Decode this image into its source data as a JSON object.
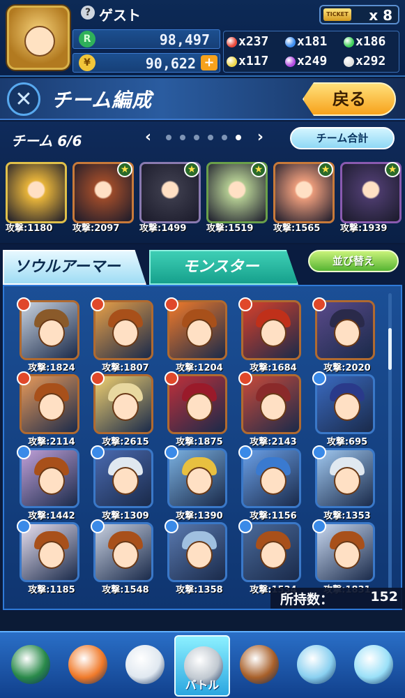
{
  "player": {
    "name": "ゲスト",
    "exp": "98,497",
    "coins": "90,622",
    "coin_add": "+"
  },
  "ticket": {
    "icon_text": "TICKET",
    "count": "x 8"
  },
  "orbs": [
    {
      "color": "#e8483a",
      "icon": "fire-orb-icon",
      "value": "x237"
    },
    {
      "color": "#3e8ef0",
      "icon": "water-orb-icon",
      "value": "x181"
    },
    {
      "color": "#3fd05a",
      "icon": "wood-orb-icon",
      "value": "x186"
    },
    {
      "color": "#f0d84a",
      "icon": "light-orb-icon",
      "value": "x117"
    },
    {
      "color": "#b04ae0",
      "icon": "dark-orb-icon",
      "value": "x249"
    },
    {
      "color": "#e0e0e0",
      "icon": "rainbow-orb-icon",
      "value": "x292"
    }
  ],
  "title": {
    "text": "チーム編成",
    "back": "戻る"
  },
  "team": {
    "label": "チーム 6/6",
    "prev": "‹",
    "next": "›",
    "dots": 6,
    "active_dot": 5,
    "sum_button": "チーム合計",
    "members": [
      {
        "atk": "攻撃:1180",
        "color": "#e6b33a",
        "border": "#e0c04a",
        "star": false
      },
      {
        "atk": "攻撃:2097",
        "color": "#9a4a2a",
        "border": "#c87a3a",
        "star": true
      },
      {
        "atk": "攻撃:1499",
        "color": "#3a3a4a",
        "border": "#8a7ab0",
        "star": true
      },
      {
        "atk": "攻撃:1519",
        "color": "#b0c890",
        "border": "#6aa04a",
        "star": true
      },
      {
        "atk": "攻撃:1565",
        "color": "#e89a7a",
        "border": "#c87a3a",
        "star": true
      },
      {
        "atk": "攻撃:1939",
        "color": "#4a3a6a",
        "border": "#8a5ab0",
        "star": true
      }
    ]
  },
  "tabs": {
    "soul_armor": "ソウルアーマー",
    "monster": "モンスター",
    "sort": "並び替え"
  },
  "grid": [
    {
      "atk": "攻撃:1824",
      "el": "#e0482a",
      "bg": "#c9d3e0",
      "hair": "#8a5a2a",
      "border": "#b06a30"
    },
    {
      "atk": "攻撃:1807",
      "el": "#e0482a",
      "bg": "#e8a048",
      "hair": "#a8501a",
      "border": "#b06a30"
    },
    {
      "atk": "攻撃:1204",
      "el": "#e0482a",
      "bg": "#f07a2a",
      "hair": "#a8501a",
      "border": "#b06a30"
    },
    {
      "atk": "攻撃:1684",
      "el": "#e0482a",
      "bg": "#d8402a",
      "hair": "#c0301a",
      "border": "#b06a30"
    },
    {
      "atk": "攻撃:2020",
      "el": "#e0482a",
      "bg": "#5a4a8a",
      "hair": "#2a2a4a",
      "border": "#b06a30"
    },
    {
      "atk": "攻撃:2114",
      "el": "#e0482a",
      "bg": "#e89a5a",
      "hair": "#a8501a",
      "border": "#b06a30"
    },
    {
      "atk": "攻撃:2615",
      "el": "#e0482a",
      "bg": "#f0d070",
      "hair": "#e8d8a0",
      "border": "#b06a30"
    },
    {
      "atk": "攻撃:1875",
      "el": "#e0482a",
      "bg": "#c0303a",
      "hair": "#9a1a2a",
      "border": "#b06a30"
    },
    {
      "atk": "攻撃:2143",
      "el": "#e0482a",
      "bg": "#c84a3a",
      "hair": "#8a2a2a",
      "border": "#b06a30"
    },
    {
      "atk": "攻撃:695",
      "el": "#3a8ae8",
      "bg": "#3a6ac0",
      "hair": "#2a3a8a",
      "border": "#3a78c8"
    },
    {
      "atk": "攻撃:1442",
      "el": "#3a8ae8",
      "bg": "#c0a0d8",
      "hair": "#a8501a",
      "border": "#3a78c8"
    },
    {
      "atk": "攻撃:1309",
      "el": "#3a8ae8",
      "bg": "#4a6ab0",
      "hair": "#e0e8f0",
      "border": "#3a78c8"
    },
    {
      "atk": "攻撃:1390",
      "el": "#3a8ae8",
      "bg": "#7ab0e0",
      "hair": "#e8c040",
      "border": "#3a78c8"
    },
    {
      "atk": "攻撃:1156",
      "el": "#3a8ae8",
      "bg": "#6aa0e8",
      "hair": "#3a7ad0",
      "border": "#3a78c8"
    },
    {
      "atk": "攻撃:1353",
      "el": "#3a8ae8",
      "bg": "#a0c8f0",
      "hair": "#e0e8f0",
      "border": "#3a78c8"
    },
    {
      "atk": "攻撃:1185",
      "el": "#3a8ae8",
      "bg": "#e8e0f0",
      "hair": "#a8501a",
      "border": "#3a78c8"
    },
    {
      "atk": "攻撃:1548",
      "el": "#3a8ae8",
      "bg": "#c8d0e0",
      "hair": "#a8501a",
      "border": "#3a78c8"
    },
    {
      "atk": "攻撃:1358",
      "el": "#3a8ae8",
      "bg": "#5a7ab0",
      "hair": "#a0c0e0",
      "border": "#3a78c8"
    },
    {
      "atk": "攻撃:1534",
      "el": "#3a8ae8",
      "bg": "#4a6a9a",
      "hair": "#a8501a",
      "border": "#3a78c8"
    },
    {
      "atk": "攻撃:1831",
      "el": "#3a8ae8",
      "bg": "#c8d8f0",
      "hair": "#a8501a",
      "border": "#3a78c8"
    }
  ],
  "owned": {
    "label": "所持数：",
    "count": "152"
  },
  "nav": [
    {
      "name": "nav-home",
      "icon": "home-icon",
      "label": "",
      "color": "#2a8a4a",
      "active": false
    },
    {
      "name": "nav-shop",
      "icon": "shop-bag-icon",
      "label": "",
      "color": "#f07a2a",
      "active": false
    },
    {
      "name": "nav-monster",
      "icon": "monster-icon",
      "label": "",
      "color": "#e0e8f0",
      "active": false
    },
    {
      "name": "nav-battle",
      "icon": "crossed-swords-icon",
      "label": "バトル",
      "color": "#c0c8d0",
      "active": true
    },
    {
      "name": "nav-book",
      "icon": "book-icon",
      "label": "",
      "color": "#a8602a",
      "active": false
    },
    {
      "name": "nav-friends",
      "icon": "friends-icon",
      "label": "",
      "color": "#8ad0f0",
      "active": false
    },
    {
      "name": "nav-help",
      "icon": "help-icon",
      "label": "",
      "color": "#9ae0f8",
      "active": false
    }
  ]
}
